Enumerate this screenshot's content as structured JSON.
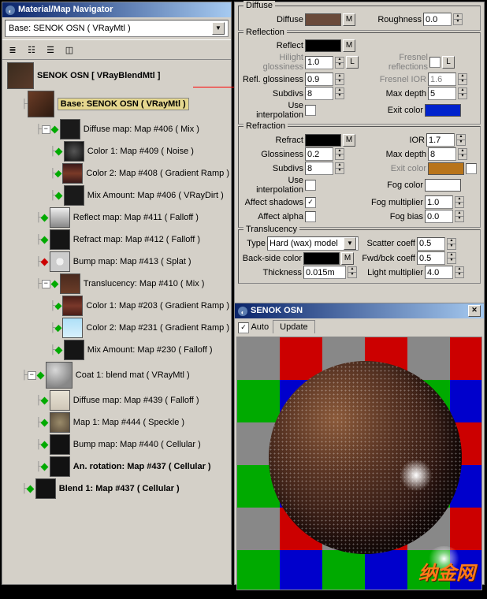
{
  "nav": {
    "title": "Material/Map Navigator",
    "dropdown": "Base: SENOK OSN  ( VRayMtl )",
    "nodes": [
      {
        "ind": 0,
        "swatch": "linear-gradient(135deg,#3a2c1e,#5a3a2a)",
        "big": true,
        "label": "SENOK OSN  [ VRayBlendMtl ]",
        "bold": true
      },
      {
        "ind": 1,
        "swatch": "linear-gradient(135deg,#6b3c26,#2c1a10)",
        "big": true,
        "label": "Base: SENOK OSN  ( VRayMtl )",
        "bold": true,
        "sel": true
      },
      {
        "ind": 2,
        "swatch": "#1a1a1a",
        "plus": true,
        "dia": "g",
        "label": "Diffuse map: Map #406  ( Mix )"
      },
      {
        "ind": 3,
        "swatch": "radial-gradient(#555,#111)",
        "dia": "g",
        "label": "Color 1: Map #409  ( Noise )"
      },
      {
        "ind": 3,
        "swatch": "linear-gradient(180deg,#3a1a1a,#7a3a28,#3a1a1a)",
        "dia": "g",
        "label": "Color 2: Map #408  ( Gradient Ramp )"
      },
      {
        "ind": 3,
        "swatch": "#1a1a1a",
        "dia": "g",
        "label": "Mix Amount: Map #406  ( VRayDirt )"
      },
      {
        "ind": 2,
        "swatch": "linear-gradient(180deg,#eee,#888)",
        "dia": "g",
        "label": "Reflect map: Map #411  ( Falloff )"
      },
      {
        "ind": 2,
        "swatch": "#151515",
        "dia": "g",
        "label": "Refract map: Map #412  ( Falloff )"
      },
      {
        "ind": 2,
        "swatch": "radial-gradient(#f0f0f0 28%,#ccc 28%)",
        "dia": "r",
        "label": "Bump map: Map #413  ( Splat )"
      },
      {
        "ind": 2,
        "swatch": "linear-gradient(180deg,#4a2a1e,#6a3c28)",
        "plus": true,
        "dia": "g",
        "label": "Translucency: Map #410  ( Mix )"
      },
      {
        "ind": 3,
        "swatch": "linear-gradient(180deg,#4a1e18,#7a382a,#4a1e18)",
        "dia": "g",
        "label": "Color 1: Map #203  ( Gradient Ramp )"
      },
      {
        "ind": 3,
        "swatch": "linear-gradient(180deg,#aee0f8,#d8f0fc)",
        "dia": "g",
        "label": "Color 2: Map #231  ( Gradient Ramp )"
      },
      {
        "ind": 3,
        "swatch": "#151515",
        "dia": "g",
        "label": "Mix Amount: Map #230  ( Falloff )"
      },
      {
        "ind": 1,
        "swatch": "radial-gradient(circle at 35% 30%,#d8d8d8,#888 70%)",
        "big": true,
        "plus": true,
        "dia": "g",
        "label": "Coat 1: blend mat  ( VRayMtl )"
      },
      {
        "ind": 2,
        "swatch": "linear-gradient(180deg,#e8e3d5,#cfc7b8)",
        "dia": "g",
        "label": "Diffuse map: Map #439  ( Falloff )"
      },
      {
        "ind": 2,
        "swatch": "radial-gradient(#9a8b6a,#5a4c3a)",
        "dia": "g",
        "label": "Map 1: Map #444  ( Speckle )"
      },
      {
        "ind": 2,
        "swatch": "#121212",
        "dia": "g",
        "label": "Bump map: Map #440  ( Cellular )"
      },
      {
        "ind": 2,
        "swatch": "#121212",
        "dia": "g",
        "label": "An. rotation: Map #437  ( Cellular )",
        "bold": true
      },
      {
        "ind": 1,
        "swatch": "#121212",
        "dia": "g",
        "label": "Blend 1: Map #437  ( Cellular )",
        "bold": true
      }
    ]
  },
  "params": {
    "diffuse": {
      "title": "Diffuse",
      "diffuse_lbl": "Diffuse",
      "color": "#6a4a3a",
      "rough_lbl": "Roughness",
      "rough": "0.0"
    },
    "reflection": {
      "title": "Reflection",
      "reflect_lbl": "Reflect",
      "color": "#000",
      "hilight_lbl": "Hilight glossiness",
      "hilight": "1.0",
      "l": "L",
      "fresnel_lbl": "Fresnel reflections",
      "reflgloss_lbl": "Refl. glossiness",
      "reflgloss": "0.9",
      "fresnelior_lbl": "Fresnel IOR",
      "fresnelior": "1.6",
      "subdivs_lbl": "Subdivs",
      "subdivs": "8",
      "maxdepth_lbl": "Max depth",
      "maxdepth": "5",
      "useintrp_lbl": "Use interpolation",
      "exit_lbl": "Exit color",
      "exit": "#0022cc"
    },
    "refraction": {
      "title": "Refraction",
      "refract_lbl": "Refract",
      "color": "#000",
      "ior_lbl": "IOR",
      "ior": "1.7",
      "gloss_lbl": "Glossiness",
      "gloss": "0.2",
      "maxdepth_lbl": "Max depth",
      "maxdepth": "8",
      "subdivs_lbl": "Subdivs",
      "subdivs": "8",
      "exit_lbl": "Exit color",
      "exit": "#b8741a",
      "useintrp_lbl": "Use interpolation",
      "fog_lbl": "Fog color",
      "fog": "#fff",
      "ashadow_lbl": "Affect shadows",
      "ashadow": true,
      "fogmult_lbl": "Fog multiplier",
      "fogmult": "1.0",
      "aalpha_lbl": "Affect alpha",
      "fogbias_lbl": "Fog bias",
      "fogbias": "0.0"
    },
    "transl": {
      "title": "Translucency",
      "type_lbl": "Type",
      "type": "Hard (wax) model",
      "scatter_lbl": "Scatter coeff",
      "scatter": "0.5",
      "back_lbl": "Back-side color",
      "back": "#000",
      "fwd_lbl": "Fwd/bck coeff",
      "fwd": "0.5",
      "thick_lbl": "Thickness",
      "thick": "0.015m",
      "light_lbl": "Light multiplier",
      "light": "4.0"
    }
  },
  "preview": {
    "title": "SENOK OSN",
    "auto": "Auto",
    "update": "Update",
    "auto_checked": true
  },
  "m": "M",
  "watermark": "纳金网"
}
